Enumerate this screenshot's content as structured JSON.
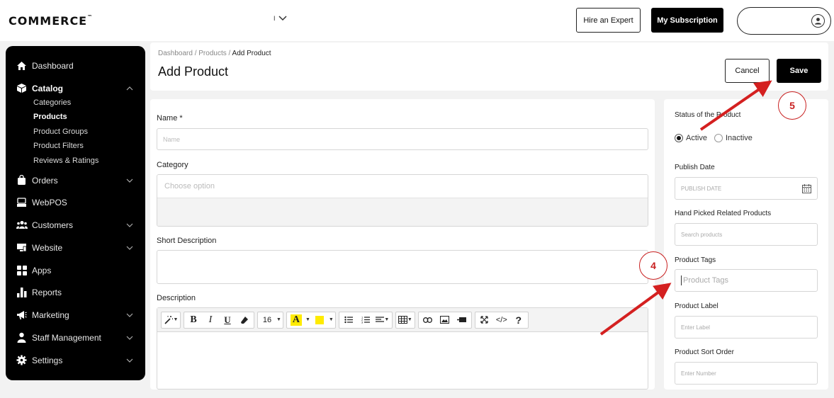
{
  "topbar": {
    "logo": "COMMERCE",
    "logo_mark": "™",
    "store_select": "I",
    "hire_label": "Hire an Expert",
    "subscription_label": "My Subscription"
  },
  "sidebar": {
    "items": [
      {
        "label": "Dashboard",
        "icon": "home-icon"
      },
      {
        "label": "Catalog",
        "icon": "box-icon",
        "expanded": true
      },
      {
        "label": "Orders",
        "icon": "bag-icon"
      },
      {
        "label": "WebPOS",
        "icon": "pos-icon"
      },
      {
        "label": "Customers",
        "icon": "users-icon"
      },
      {
        "label": "Website",
        "icon": "monitor-icon"
      },
      {
        "label": "Apps",
        "icon": "grid-icon"
      },
      {
        "label": "Reports",
        "icon": "bar-chart-icon"
      },
      {
        "label": "Marketing",
        "icon": "megaphone-icon"
      },
      {
        "label": "Staff Management",
        "icon": "staff-icon"
      },
      {
        "label": "Settings",
        "icon": "gear-icon"
      }
    ],
    "catalog_sub": [
      {
        "label": "Categories"
      },
      {
        "label": "Products",
        "active": true
      },
      {
        "label": "Product Groups"
      },
      {
        "label": "Product Filters"
      },
      {
        "label": "Reviews & Ratings"
      }
    ]
  },
  "header": {
    "breadcrumb_root": "Dashboard",
    "breadcrumb_mid": "Products",
    "breadcrumb_current": "Add Product",
    "title": "Add Product",
    "cancel_label": "Cancel",
    "save_label": "Save"
  },
  "form": {
    "name_label": "Name *",
    "name_placeholder": "Name",
    "category_label": "Category",
    "category_placeholder": "Choose option",
    "short_desc_label": "Short Description",
    "description_label": "Description",
    "font_size": "16"
  },
  "side": {
    "status_label": "Status of the Product",
    "active_label": "Active",
    "inactive_label": "Inactive",
    "publish_label": "Publish Date",
    "publish_placeholder": "PUBLISH DATE",
    "related_label": "Hand Picked Related Products",
    "related_placeholder": "Search products",
    "tags_label": "Product Tags",
    "tags_placeholder": "Product Tags",
    "label_label": "Product Label",
    "label_placeholder": "Enter Label",
    "sort_label": "Product Sort Order",
    "sort_placeholder": "Enter Number"
  },
  "annotations": {
    "step4": "4",
    "step5": "5"
  },
  "colors": {
    "accent": "#000000",
    "annotation": "#d42020"
  }
}
